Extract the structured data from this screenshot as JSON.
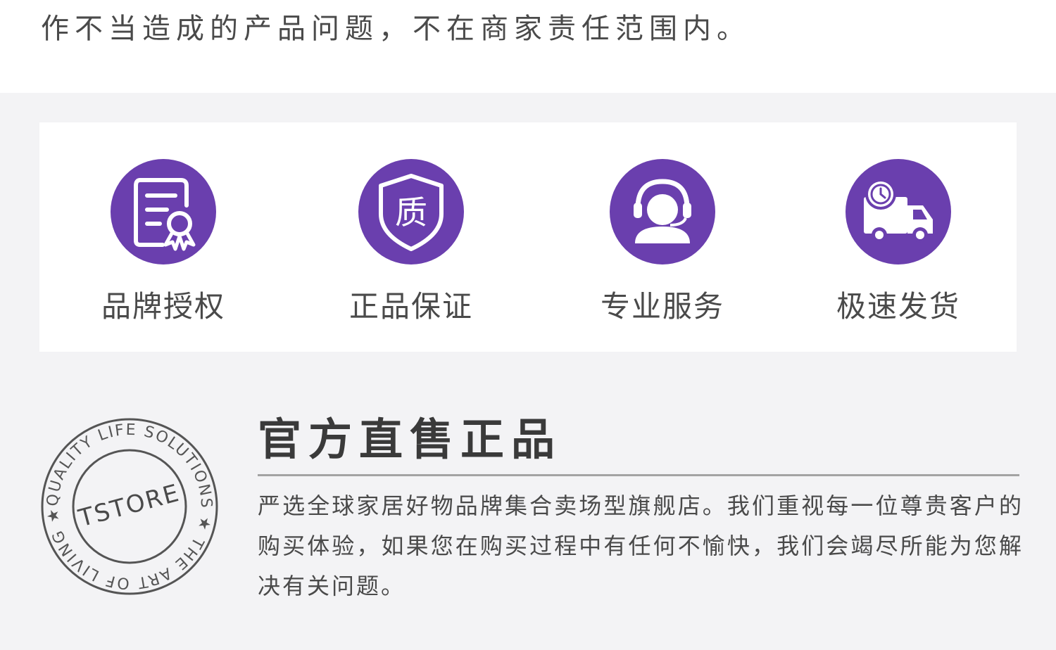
{
  "notice": {
    "text": "作不当造成的产品问题，不在商家责任范围内。"
  },
  "features": [
    {
      "label": "品牌授权",
      "icon": "certificate-icon"
    },
    {
      "label": "正品保证",
      "icon": "quality-shield-icon",
      "icon_text": "质"
    },
    {
      "label": "专业服务",
      "icon": "customer-service-icon"
    },
    {
      "label": "极速发货",
      "icon": "delivery-truck-icon"
    }
  ],
  "seal": {
    "outer_text": "QUALITY LIFE SOLUTIONS ★ THE ART OF LIVING ★",
    "center_text": "TSTORE"
  },
  "official": {
    "heading": "官方直售正品",
    "body": "严选全球家居好物品牌集合卖场型旗舰店。我们重视每一位尊贵客户的购买体验，如果您在购买过程中有任何不愉快，我们会竭尽所能为您解决有关问题。"
  },
  "colors": {
    "accent": "#6a3fae",
    "text": "#4a4a4a",
    "background": "#f3f3f5",
    "card": "#ffffff"
  }
}
